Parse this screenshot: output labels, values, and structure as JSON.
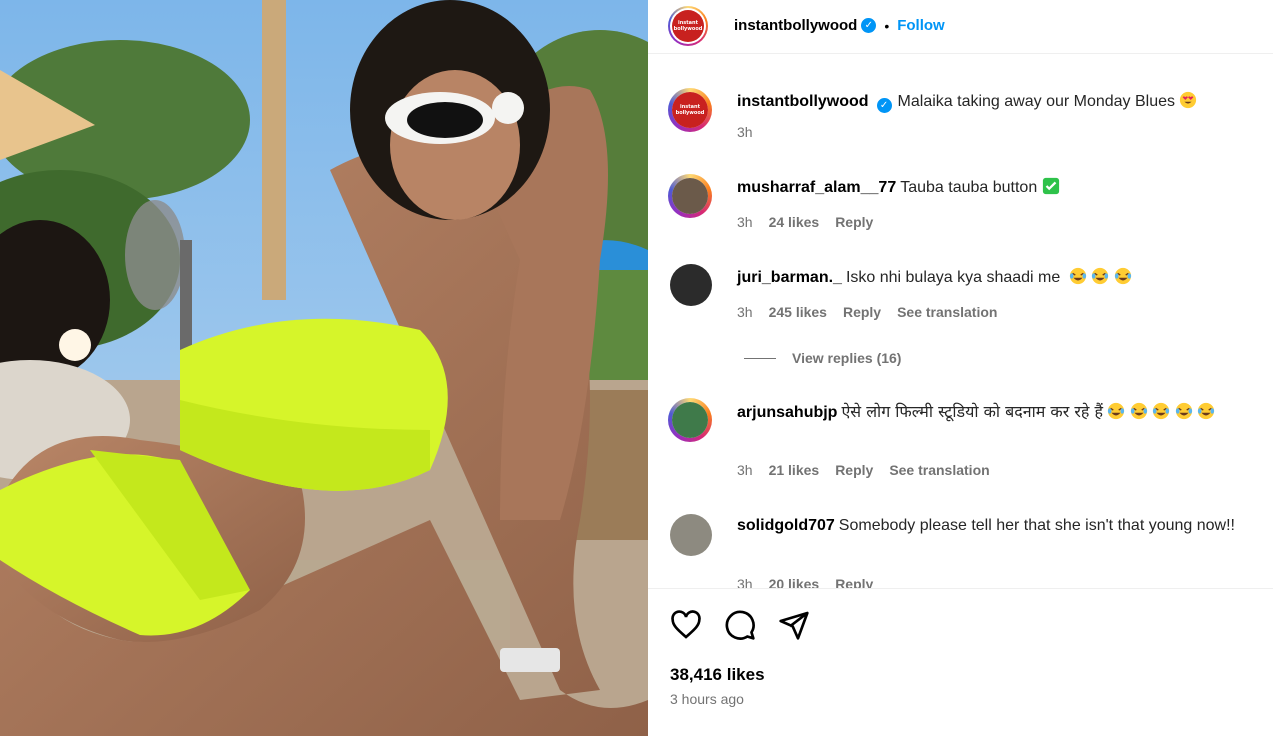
{
  "post": {
    "author": "instantbollywood",
    "follow_label": "Follow",
    "dot": "•",
    "logo_text_line1": "instant",
    "logo_text_line2": "bollywood"
  },
  "caption": {
    "username": "instantbollywood",
    "text": "Malaika taking away our Monday Blues",
    "emoji": "heart-eyes-emoji",
    "time": "3h"
  },
  "comments": [
    {
      "username": "musharraf_alam__77",
      "text": "Tauba tauba button",
      "emoji": "check-mark-emoji",
      "time": "3h",
      "likes": "24 likes",
      "reply": "Reply"
    },
    {
      "username": "juri_barman._",
      "text": "Isko nhi bulaya kya shaadi me",
      "emoji": "laughing-emoji",
      "time": "3h",
      "likes": "245 likes",
      "reply": "Reply",
      "translate": "See translation",
      "view_replies": "View replies (16)"
    },
    {
      "username": "arjunsahubjp",
      "text": "ऐसे लोग फिल्मी स्टूडियो को बदनाम कर रहे हैं",
      "emoji": "laughing-emoji",
      "time": "3h",
      "likes": "21 likes",
      "reply": "Reply",
      "translate": "See translation"
    },
    {
      "username": "solidgold707",
      "text": "Somebody please tell her that she isn't that young now!!",
      "time": "3h",
      "likes": "20 likes",
      "reply": "Reply"
    }
  ],
  "footer": {
    "likes": "38,416 likes",
    "time": "3 hours ago"
  },
  "colors": {
    "accent": "#0095f6",
    "muted": "#737373",
    "swimsuit": "#d6f52a"
  }
}
